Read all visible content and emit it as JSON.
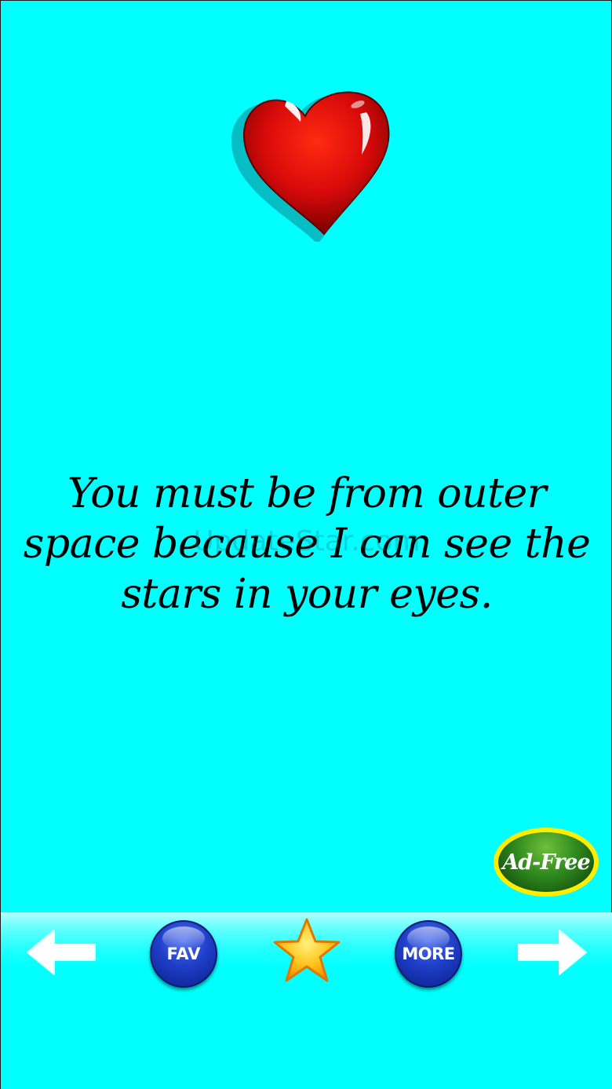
{
  "quote": {
    "text": "You must be from outer space because I can see the stars in your eyes."
  },
  "watermark": {
    "text": "UpdateStar.com"
  },
  "ad_free_button": {
    "label": "Ad-Free"
  },
  "bottom_bar": {
    "previous_icon": "arrow-left-icon",
    "fav_label": "FAV",
    "favorite_icon": "star-icon",
    "more_label": "MORE",
    "next_icon": "arrow-right-icon"
  },
  "colors": {
    "background": "#00ffff",
    "heart": "#e01010",
    "button_blue": "#1f3fc8",
    "star": "#ffc21a",
    "ad_free_ring": "#ffee00",
    "ad_free_fill": "#2f8a1e"
  }
}
